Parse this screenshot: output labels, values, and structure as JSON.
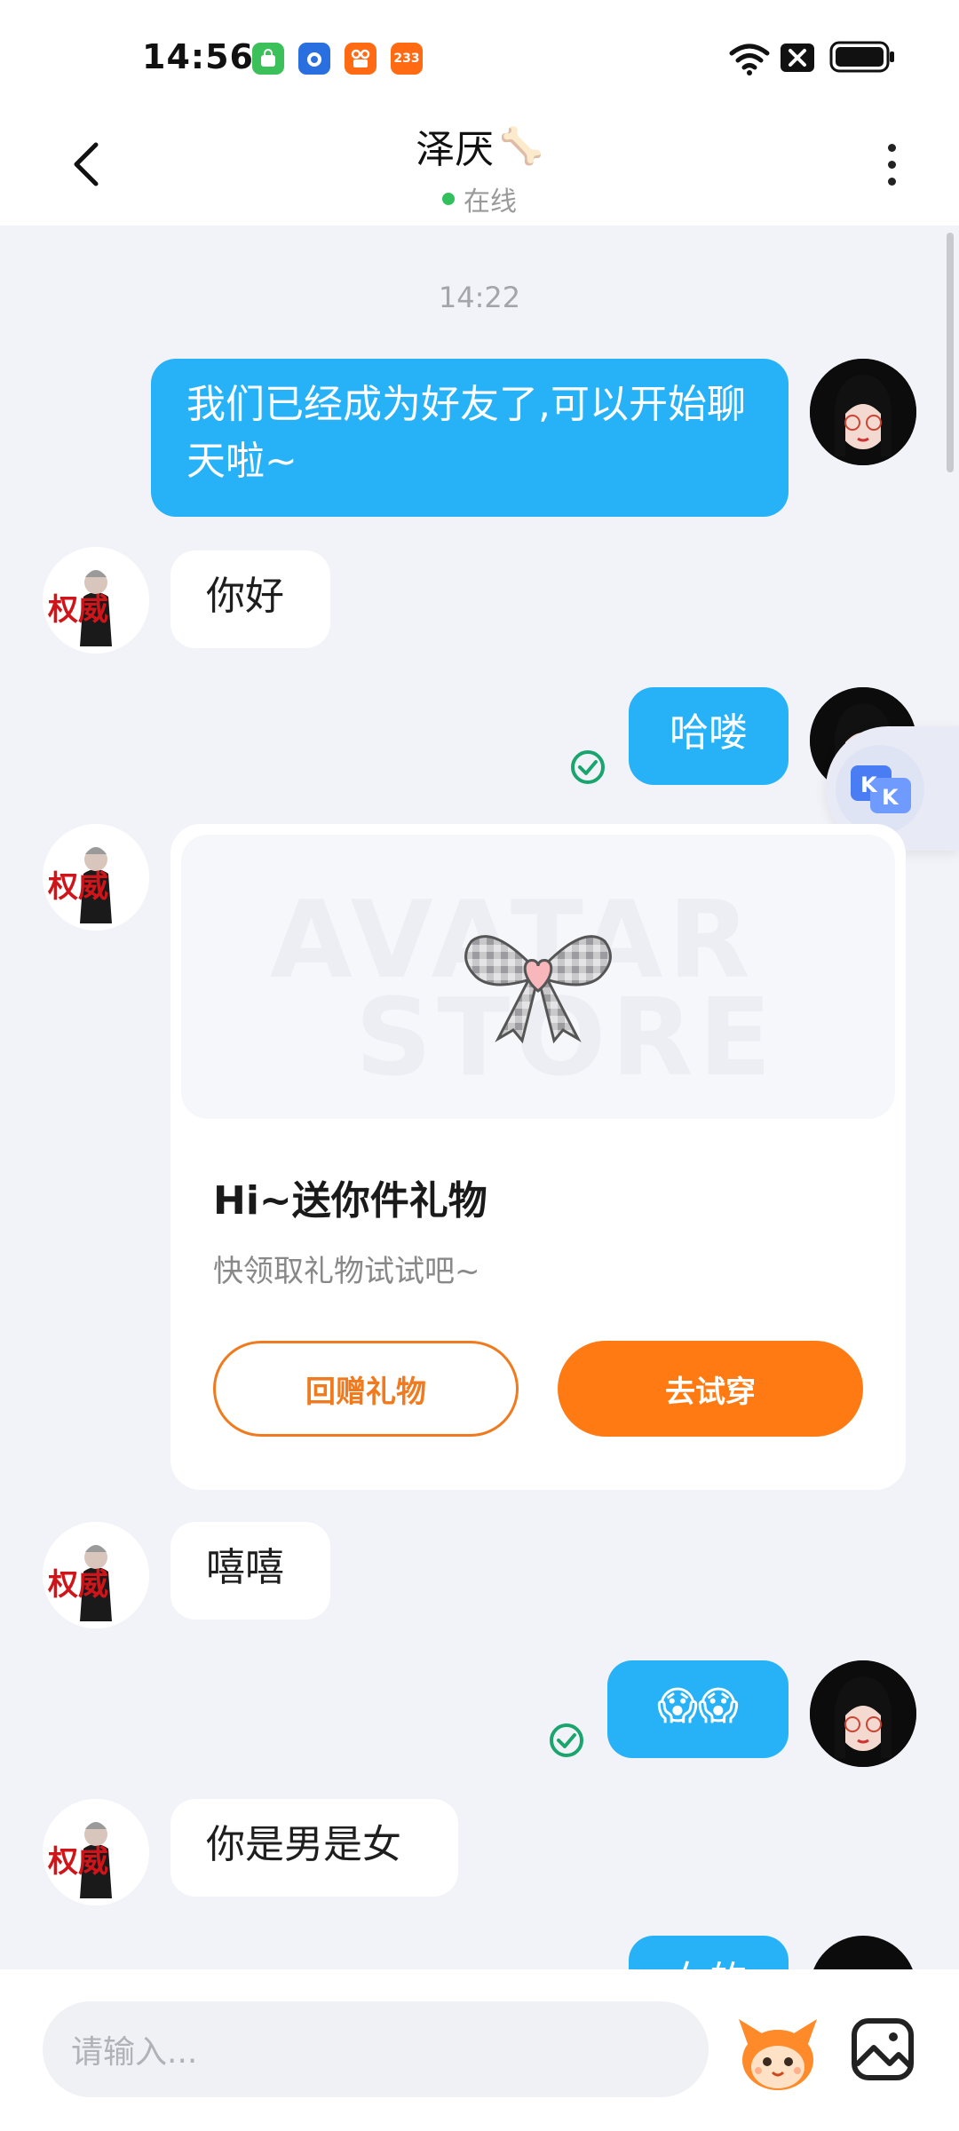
{
  "status_bar": {
    "time": "14:56",
    "app_icons": [
      {
        "name": "shopping-app-icon",
        "label": "",
        "color": "#3cc05a"
      },
      {
        "name": "baidu-app-icon",
        "label": "",
        "color": "#2a6fe0"
      },
      {
        "name": "kuaishou-app-icon",
        "label": "",
        "color": "#ff6a13"
      },
      {
        "name": "233-app-icon",
        "label": "233",
        "color": "#ff6a13"
      }
    ]
  },
  "header": {
    "title": "泽厌",
    "title_emoji": "🦴",
    "status": "在线"
  },
  "chat": {
    "timestamp": "14:22",
    "messages": [
      {
        "from": "me",
        "text": "我们已经成为好友了,可以开始聊天啦~"
      },
      {
        "from": "other",
        "text": "你好"
      },
      {
        "from": "me",
        "text": "哈喽",
        "read": true
      },
      {
        "from": "other",
        "type": "gift"
      },
      {
        "from": "other",
        "text": "嘻嘻"
      },
      {
        "from": "me",
        "text": "😱😱",
        "read": true
      },
      {
        "from": "other",
        "text": "你是男是女"
      },
      {
        "from": "me",
        "text": "女的"
      }
    ],
    "gift_card": {
      "watermark_1": "AVATAR",
      "watermark_2": "STORE",
      "title": "Hi~送你件礼物",
      "subtitle": "快领取礼物试试吧~",
      "return_button": "回赠礼物",
      "try_button": "去试穿"
    },
    "other_avatar_text": "权威"
  },
  "input_bar": {
    "placeholder": "请输入..."
  },
  "colors": {
    "my_bubble": "#27b2f7",
    "accent_orange": "#ff7a12",
    "online_dot": "#31c05c",
    "read_check": "#1aa56f"
  }
}
